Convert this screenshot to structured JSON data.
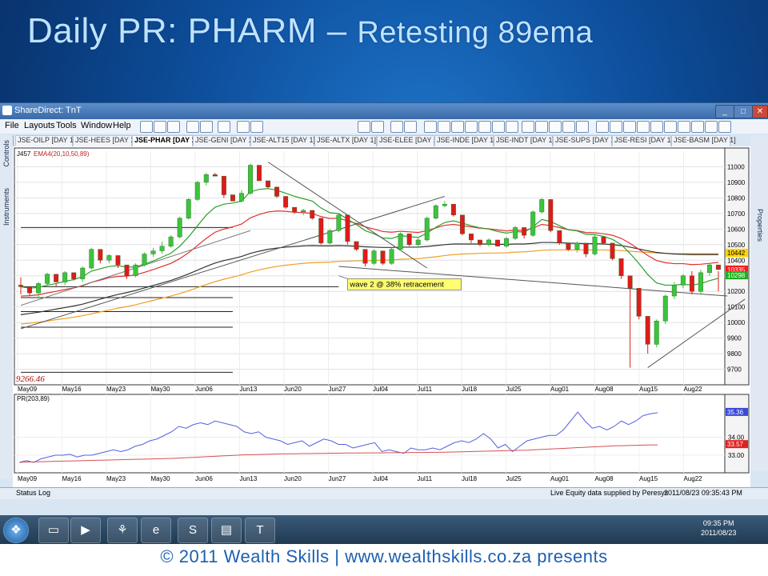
{
  "slide": {
    "title_main": "Daily PR: PHARM –",
    "title_sub": "Retesting 89ema",
    "footer": "© 2011 Wealth Skills | www.wealthskills.co.za presents"
  },
  "window": {
    "title": "ShareDirect: TnT",
    "menus": [
      "File",
      "Layouts",
      "Tools",
      "Window",
      "Help"
    ],
    "tabs": [
      "JSE-OILP [DAY 1]",
      "JSE-HEES [DAY 1]",
      "JSE-PHAR [DAY 1]",
      "JSE-GENI [DAY 1]",
      "JSE-ALT15 [DAY 1]",
      "JSE-ALTX [DAY 1]",
      "JSE-ELEE [DAY 1]",
      "JSE-INDE [DAY 1]",
      "JSE-INDT [DAY 1]",
      "JSE-SUPS [DAY 1]",
      "JSE-RESI [DAY 1]",
      "JSE-BASM [DAY 1]"
    ],
    "rail_left": [
      "Controls",
      "Instruments"
    ],
    "rail_right": "Properties",
    "status_log": "Status Log",
    "status_data": "Live Equity data supplied by Peresys",
    "status_time": "2011/08/23 09:35:43 PM",
    "clock_time": "09:35 PM",
    "clock_date": "2011/08/23"
  },
  "icons": [
    "window-icon",
    "minimize-icon",
    "maximize-icon",
    "close-icon",
    "start-icon",
    "folder-icon",
    "media-icon",
    "chart-icon",
    "ie-icon",
    "skype-icon",
    "doc-icon",
    "tnt-icon"
  ],
  "chart_data": [
    {
      "type": "candlestick",
      "panel": "price",
      "instrument": "J457",
      "indicator_label": "EMA4(20,10,50,89)",
      "low_marker": "9266.46",
      "annotation": "wave 2 @ 38% retracement",
      "ylim": [
        9600,
        11100
      ],
      "y_ticks": [
        11000,
        10900,
        10800,
        10700,
        10600,
        10500,
        10400,
        10300,
        10200,
        10100,
        10000,
        9900,
        9800,
        9700
      ],
      "x_ticks": [
        "May09",
        "May16",
        "May23",
        "May30",
        "Jun06",
        "Jun13",
        "Jun20",
        "Jun27",
        "Jul04",
        "Jul11",
        "Jul18",
        "Jul25",
        "Aug01",
        "Aug08",
        "Aug15",
        "Aug22"
      ],
      "price_labels": [
        {
          "text": "10442",
          "color": "#ffd400"
        },
        {
          "text": "10335",
          "color": "#ff1a1a"
        },
        {
          "text": "10298",
          "color": "#1fae1f"
        }
      ],
      "candles": [
        [
          10240,
          10290,
          10180,
          10230
        ],
        [
          10230,
          10220,
          10170,
          10190
        ],
        [
          10190,
          10260,
          10160,
          10250
        ],
        [
          10250,
          10320,
          10230,
          10310
        ],
        [
          10310,
          10250,
          10230,
          10260
        ],
        [
          10260,
          10330,
          10240,
          10320
        ],
        [
          10320,
          10290,
          10270,
          10280
        ],
        [
          10280,
          10360,
          10260,
          10350
        ],
        [
          10350,
          10480,
          10340,
          10470
        ],
        [
          10470,
          10420,
          10380,
          10400
        ],
        [
          10400,
          10440,
          10380,
          10430
        ],
        [
          10430,
          10380,
          10350,
          10370
        ],
        [
          10370,
          10320,
          10280,
          10300
        ],
        [
          10300,
          10380,
          10290,
          10370
        ],
        [
          10370,
          10450,
          10360,
          10440
        ],
        [
          10440,
          10480,
          10420,
          10460
        ],
        [
          10460,
          10520,
          10440,
          10490
        ],
        [
          10490,
          10560,
          10480,
          10550
        ],
        [
          10550,
          10680,
          10540,
          10670
        ],
        [
          10670,
          10800,
          10660,
          10790
        ],
        [
          10790,
          10910,
          10780,
          10900
        ],
        [
          10900,
          10960,
          10880,
          10950
        ],
        [
          10950,
          10960,
          10940,
          10940
        ],
        [
          10940,
          10880,
          10800,
          10820
        ],
        [
          10820,
          10790,
          10780,
          10780
        ],
        [
          10780,
          10850,
          10770,
          10830
        ],
        [
          10830,
          11020,
          10820,
          11010
        ],
        [
          11010,
          10930,
          10910,
          10910
        ],
        [
          10910,
          10880,
          10860,
          10870
        ],
        [
          10870,
          10820,
          10800,
          10810
        ],
        [
          10810,
          10750,
          10730,
          10740
        ],
        [
          10740,
          10720,
          10700,
          10710
        ],
        [
          10710,
          10730,
          10690,
          10720
        ],
        [
          10720,
          10680,
          10660,
          10670
        ],
        [
          10670,
          10530,
          10500,
          10510
        ],
        [
          10510,
          10600,
          10500,
          10590
        ],
        [
          10590,
          10700,
          10580,
          10690
        ],
        [
          10690,
          10660,
          10500,
          10520
        ],
        [
          10520,
          10510,
          10460,
          10470
        ],
        [
          10470,
          10390,
          10360,
          10380
        ],
        [
          10380,
          10470,
          10370,
          10460
        ],
        [
          10460,
          10420,
          10370,
          10380
        ],
        [
          10380,
          10480,
          10370,
          10470
        ],
        [
          10470,
          10580,
          10460,
          10570
        ],
        [
          10570,
          10560,
          10490,
          10500
        ],
        [
          10500,
          10540,
          10480,
          10530
        ],
        [
          10530,
          10680,
          10520,
          10670
        ],
        [
          10670,
          10760,
          10660,
          10750
        ],
        [
          10750,
          10780,
          10740,
          10760
        ],
        [
          10760,
          10690,
          10680,
          10690
        ],
        [
          10690,
          10580,
          10560,
          10570
        ],
        [
          10570,
          10540,
          10510,
          10530
        ],
        [
          10530,
          10510,
          10490,
          10500
        ],
        [
          10500,
          10540,
          10490,
          10530
        ],
        [
          10530,
          10500,
          10490,
          10490
        ],
        [
          10490,
          10550,
          10480,
          10540
        ],
        [
          10540,
          10620,
          10530,
          10610
        ],
        [
          10610,
          10590,
          10540,
          10560
        ],
        [
          10560,
          10720,
          10550,
          10710
        ],
        [
          10710,
          10800,
          10700,
          10790
        ],
        [
          10790,
          10600,
          10580,
          10590
        ],
        [
          10590,
          10530,
          10500,
          10510
        ],
        [
          10510,
          10480,
          10460,
          10470
        ],
        [
          10470,
          10520,
          10450,
          10510
        ],
        [
          10510,
          10470,
          10420,
          10440
        ],
        [
          10440,
          10560,
          10430,
          10550
        ],
        [
          10550,
          10520,
          10500,
          10510
        ],
        [
          10510,
          10420,
          10400,
          10410
        ],
        [
          10410,
          10330,
          10280,
          10300
        ],
        [
          10300,
          10250,
          9710,
          10220
        ],
        [
          10220,
          10050,
          10020,
          10040
        ],
        [
          10040,
          9880,
          9800,
          9860
        ],
        [
          9860,
          10020,
          9840,
          10010
        ],
        [
          10010,
          10180,
          9990,
          10170
        ],
        [
          10170,
          10260,
          10150,
          10240
        ],
        [
          10240,
          10310,
          10220,
          10300
        ],
        [
          10300,
          10330,
          10180,
          10200
        ],
        [
          10200,
          10340,
          10180,
          10320
        ],
        [
          10320,
          10380,
          10300,
          10370
        ],
        [
          10370,
          10330,
          10200,
          10340
        ]
      ],
      "ema_green": [
        10230,
        10220,
        10225,
        10240,
        10250,
        10265,
        10275,
        10295,
        10330,
        10345,
        10360,
        10365,
        10355,
        10357,
        10375,
        10395,
        10420,
        10445,
        10490,
        10550,
        10620,
        10690,
        10740,
        10760,
        10767,
        10780,
        10840,
        10855,
        10860,
        10850,
        10830,
        10810,
        10795,
        10780,
        10735,
        10705,
        10700,
        10662,
        10630,
        10590,
        10570,
        10543,
        10540,
        10558,
        10552,
        10546,
        10574,
        10611,
        10642,
        10653,
        10638,
        10622,
        10608,
        10600,
        10584,
        10574,
        10584,
        10580,
        10614,
        10662,
        10648,
        10622,
        10596,
        10588,
        10567,
        10564,
        10553,
        10534,
        10500,
        10443,
        10379,
        10308,
        10254,
        10240,
        10240,
        10246,
        10240,
        10250,
        10269,
        10284
      ],
      "ema_red": [
        10170,
        10172,
        10178,
        10190,
        10200,
        10212,
        10222,
        10236,
        10258,
        10272,
        10288,
        10296,
        10298,
        10306,
        10322,
        10340,
        10360,
        10380,
        10410,
        10448,
        10494,
        10540,
        10580,
        10600,
        10614,
        10632,
        10672,
        10694,
        10710,
        10716,
        10714,
        10708,
        10706,
        10700,
        10680,
        10668,
        10670,
        10652,
        10636,
        10614,
        10600,
        10584,
        10580,
        10586,
        10582,
        10578,
        10590,
        10608,
        10624,
        10630,
        10622,
        10614,
        10606,
        10602,
        10594,
        10588,
        10592,
        10590,
        10606,
        10630,
        10622,
        10610,
        10596,
        10590,
        10578,
        10576,
        10570,
        10560,
        10540,
        10508,
        10470,
        10430,
        10398,
        10384,
        10378,
        10378,
        10372,
        10374,
        10380,
        10386
      ],
      "ema_black": [
        10050,
        10058,
        10066,
        10076,
        10086,
        10096,
        10106,
        10118,
        10134,
        10150,
        10166,
        10180,
        10192,
        10206,
        10222,
        10238,
        10254,
        10270,
        10290,
        10312,
        10336,
        10360,
        10382,
        10398,
        10410,
        10424,
        10444,
        10458,
        10470,
        10478,
        10484,
        10488,
        10492,
        10494,
        10492,
        10492,
        10494,
        10492,
        10490,
        10486,
        10484,
        10482,
        10482,
        10484,
        10484,
        10484,
        10488,
        10494,
        10500,
        10504,
        10504,
        10504,
        10504,
        10504,
        10502,
        10502,
        10504,
        10504,
        10508,
        10514,
        10514,
        10512,
        10510,
        10508,
        10506,
        10506,
        10504,
        10500,
        10494,
        10484,
        10472,
        10460,
        10450,
        10444,
        10440,
        10438,
        10436,
        10436,
        10436,
        10436
      ],
      "ema_orange": [
        9990,
        9996,
        10002,
        10010,
        10018,
        10026,
        10034,
        10044,
        10056,
        10068,
        10080,
        10092,
        10102,
        10114,
        10128,
        10142,
        10156,
        10170,
        10186,
        10204,
        10224,
        10244,
        10262,
        10278,
        10292,
        10306,
        10324,
        10338,
        10350,
        10360,
        10368,
        10374,
        10380,
        10384,
        10386,
        10388,
        10392,
        10394,
        10396,
        10396,
        10398,
        10400,
        10402,
        10406,
        10408,
        10410,
        10416,
        10422,
        10430,
        10436,
        10440,
        10442,
        10444,
        10446,
        10446,
        10448,
        10452,
        10454,
        10458,
        10464,
        10466,
        10466,
        10466,
        10466,
        10466,
        10466,
        10466,
        10464,
        10462,
        10458,
        10454,
        10450,
        10446,
        10444,
        10442,
        10442,
        10442,
        10442,
        10442,
        10442
      ],
      "trendlines": [
        {
          "from": [
            0,
            9960
          ],
          "to": [
            48,
            10810
          ],
          "color": "#555555"
        },
        {
          "from": [
            0,
            10110
          ],
          "to": [
            26,
            10590
          ],
          "color": "#777777"
        },
        {
          "from": [
            28,
            11030
          ],
          "to": [
            46,
            10350
          ],
          "color": "#555555"
        },
        {
          "from": [
            36,
            10360
          ],
          "to": [
            80,
            10170
          ],
          "color": "#555555"
        },
        {
          "from": [
            71,
            9710
          ],
          "to": [
            82,
            10150
          ],
          "color": "#555555"
        }
      ],
      "hlines": [
        {
          "y": 10610,
          "x0": 0,
          "x1": 24
        },
        {
          "y": 10230,
          "x0": 0,
          "x1": 36
        },
        {
          "y": 10160,
          "x0": 0,
          "x1": 24
        },
        {
          "y": 10070,
          "x0": 0,
          "x1": 24
        },
        {
          "y": 9970,
          "x0": 0,
          "x1": 24
        },
        {
          "y": 9680,
          "x0": 0,
          "x1": 24
        }
      ]
    },
    {
      "type": "line",
      "panel": "indicator",
      "indicator_label": "PR(203,89)",
      "ylim": [
        32.2,
        36.2
      ],
      "y_ticks": [
        34.0,
        33.0
      ],
      "price_labels": [
        {
          "text": "35.36",
          "color": "#3b49d8"
        },
        {
          "text": "33.57",
          "color": "#e02020"
        }
      ],
      "series": [
        {
          "color": "#5560e0",
          "values": [
            32.6,
            32.7,
            32.6,
            32.8,
            32.9,
            33.0,
            33.0,
            33.05,
            32.9,
            33.0,
            33.0,
            33.1,
            33.2,
            33.3,
            33.2,
            33.3,
            33.5,
            33.6,
            33.8,
            33.9,
            34.1,
            34.3,
            34.6,
            34.5,
            34.7,
            34.8,
            34.7,
            34.9,
            34.8,
            34.7,
            34.6,
            34.3,
            34.2,
            34.3,
            34.0,
            33.9,
            33.8,
            33.6,
            33.7,
            33.8,
            33.5,
            33.7,
            33.9,
            33.8,
            33.6,
            33.6,
            33.4,
            33.5,
            33.6,
            33.7,
            33.2,
            33.3,
            33.2,
            33.1,
            33.4,
            33.3,
            33.3,
            33.4,
            33.3,
            33.5,
            33.7,
            33.8,
            33.7,
            33.9,
            34.2,
            33.9,
            33.4,
            33.6,
            33.2,
            33.5,
            33.8,
            33.9,
            34.0,
            34.1,
            34.1,
            34.4,
            34.9,
            35.4,
            34.9,
            34.5,
            34.6,
            34.4,
            34.6,
            34.9,
            34.7,
            34.9,
            35.2,
            35.3,
            35.36
          ]
        },
        {
          "color": "#d85050",
          "values": [
            32.6,
            32.62,
            32.63,
            32.64,
            32.65,
            32.66,
            32.67,
            32.68,
            32.69,
            32.7,
            32.71,
            32.72,
            32.73,
            32.74,
            32.75,
            32.76,
            32.77,
            32.78,
            32.79,
            32.8,
            32.81,
            32.82,
            32.84,
            32.86,
            32.88,
            32.9,
            32.92,
            32.94,
            32.96,
            32.98,
            33.0,
            33.02,
            33.03,
            33.04,
            33.05,
            33.06,
            33.07,
            33.08,
            33.08,
            33.09,
            33.09,
            33.1,
            33.1,
            33.11,
            33.11,
            33.12,
            33.12,
            33.12,
            33.13,
            33.13,
            33.13,
            33.14,
            33.14,
            33.14,
            33.15,
            33.15,
            33.15,
            33.16,
            33.16,
            33.17,
            33.18,
            33.19,
            33.2,
            33.21,
            33.22,
            33.23,
            33.24,
            33.25,
            33.26,
            33.27,
            33.28,
            33.3,
            33.32,
            33.34,
            33.36,
            33.38,
            33.4,
            33.42,
            33.44,
            33.46,
            33.48,
            33.5,
            33.52,
            33.53,
            33.54,
            33.55,
            33.56,
            33.57,
            33.57
          ]
        }
      ]
    }
  ]
}
